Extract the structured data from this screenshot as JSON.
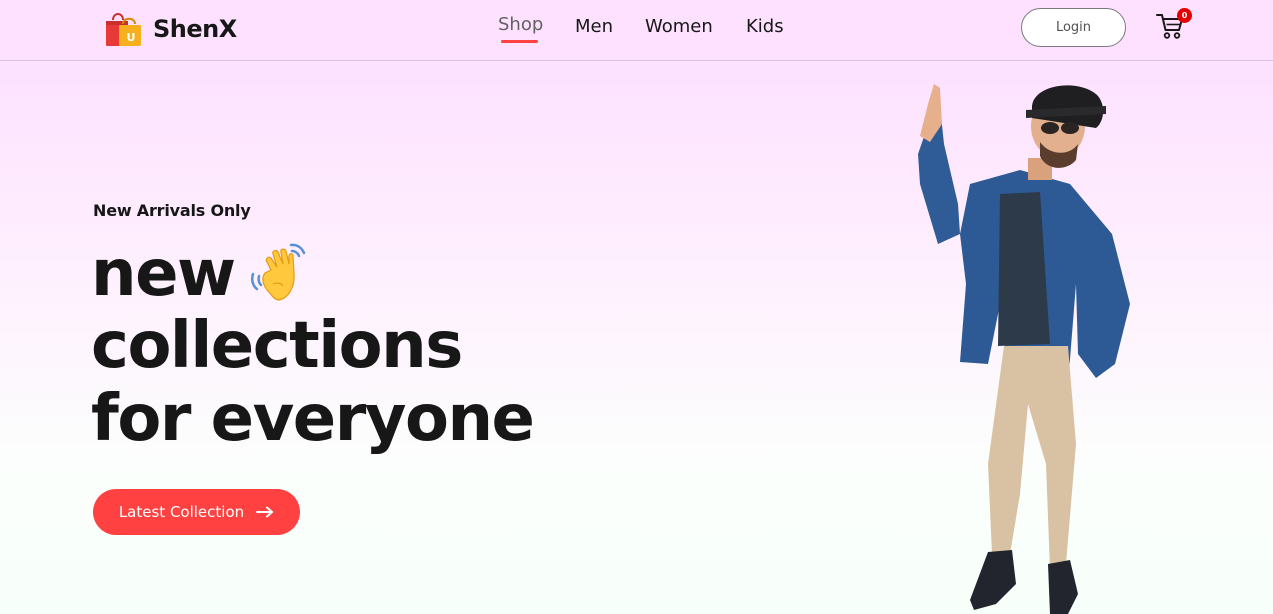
{
  "brand": {
    "name": "ShenX",
    "logo_icon": "shopping-bags-icon"
  },
  "nav": {
    "items": [
      {
        "label": "Shop",
        "active": true
      },
      {
        "label": "Men",
        "active": false
      },
      {
        "label": "Women",
        "active": false
      },
      {
        "label": "Kids",
        "active": false
      }
    ]
  },
  "header": {
    "login_label": "Login",
    "cart_count": "0",
    "cart_icon": "cart-icon"
  },
  "hero": {
    "tagline": "New Arrivals Only",
    "line1": "new",
    "line2": "collections",
    "line3": "for everyone",
    "wave_icon": "waving-hand-icon",
    "cta_label": "Latest Collection",
    "cta_icon": "arrow-right-icon",
    "image": "man-in-hat-pointing-up"
  },
  "colors": {
    "accent": "#ff4141",
    "header_bg": "#fde1ff",
    "text": "#171717",
    "badge": "#e40000"
  }
}
